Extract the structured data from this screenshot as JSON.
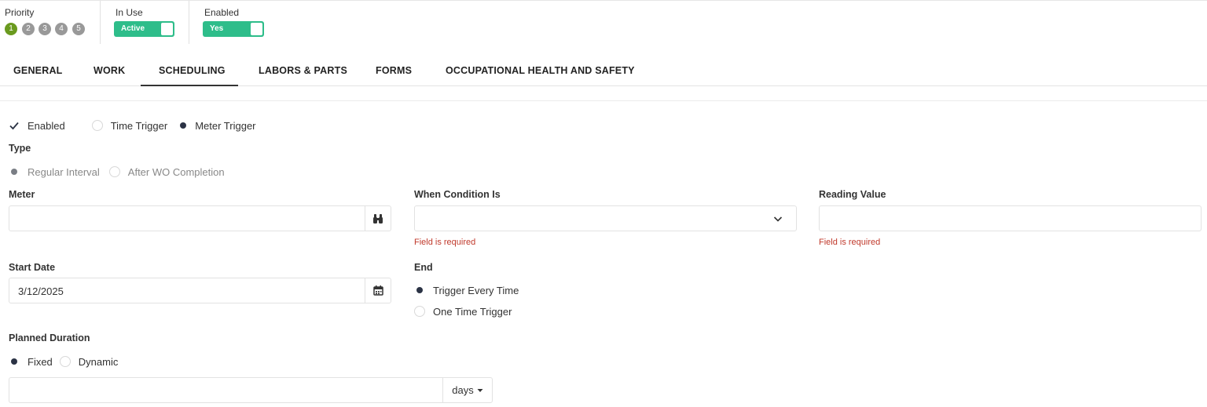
{
  "header": {
    "priority": {
      "label": "Priority",
      "levels": [
        "1",
        "2",
        "3",
        "4",
        "5"
      ],
      "selected": "1"
    },
    "in_use": {
      "label": "In Use",
      "toggle_text": "Active"
    },
    "enabled": {
      "label": "Enabled",
      "toggle_text": "Yes"
    }
  },
  "tabs": [
    {
      "label": "GENERAL"
    },
    {
      "label": "WORK"
    },
    {
      "label": "SCHEDULING",
      "active": true
    },
    {
      "label": "LABORS & PARTS"
    },
    {
      "label": "FORMS"
    },
    {
      "label": "OCCUPATIONAL HEALTH AND SAFETY"
    }
  ],
  "scheduling": {
    "enabled_check": "Enabled",
    "trigger_options": [
      "Time Trigger",
      "Meter Trigger"
    ],
    "trigger_selected": "Meter Trigger",
    "type_label": "Type",
    "type_options": [
      "Regular Interval",
      "After WO Completion"
    ],
    "meter": {
      "label": "Meter",
      "value": "",
      "icon": "binoculars-icon"
    },
    "condition": {
      "label": "When Condition Is",
      "value": "",
      "error": "Field is required",
      "icon": "chevron-down-icon"
    },
    "reading": {
      "label": "Reading Value",
      "value": "",
      "error": "Field is required"
    },
    "start_date": {
      "label": "Start Date",
      "value": "3/12/2025",
      "icon": "calendar-icon"
    },
    "end": {
      "label": "End",
      "options": [
        "Trigger Every Time",
        "One Time Trigger"
      ],
      "selected": "Trigger Every Time"
    },
    "planned_duration": {
      "label": "Planned Duration",
      "options": [
        "Fixed",
        "Dynamic"
      ],
      "selected": "Fixed",
      "value": "",
      "unit": "days"
    }
  },
  "colors": {
    "accent_green": "#2ebd8a",
    "priority_active": "#6a9a1f",
    "error": "#c0392b",
    "radio_dark": "#2b3345"
  }
}
